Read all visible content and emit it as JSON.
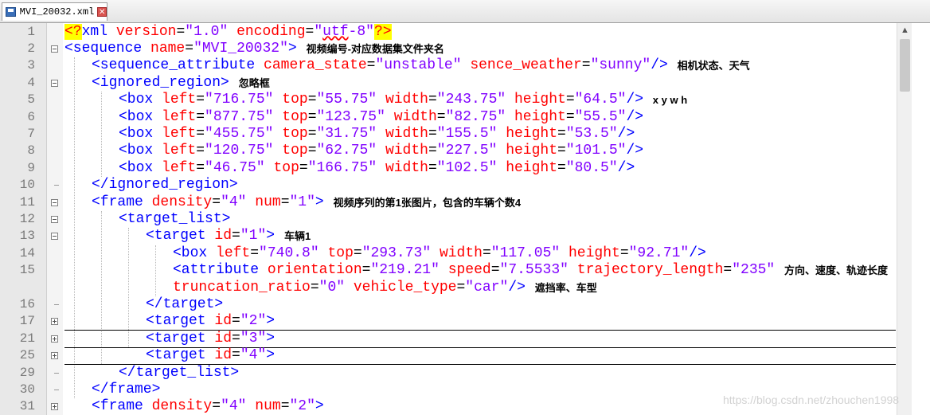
{
  "tab": {
    "label": "MVI_20032.xml",
    "close_glyph": "✕",
    "save_icon": "floppy-disk-icon"
  },
  "scrollbar": {
    "up_glyph": "▲"
  },
  "lines": [
    {
      "num": "1",
      "indent": 0,
      "fold": "none",
      "tokens": [
        {
          "t": "<?",
          "c": "pi"
        },
        {
          "t": "xml ",
          "c": "tag"
        },
        {
          "t": "version",
          "c": "attr"
        },
        {
          "t": "=",
          "c": "plain"
        },
        {
          "t": "\"1.0\"",
          "c": "val"
        },
        {
          "t": " ",
          "c": "plain"
        },
        {
          "t": "encoding",
          "c": "attr"
        },
        {
          "t": "=",
          "c": "plain"
        },
        {
          "t": "\"",
          "c": "val"
        },
        {
          "t": "utf",
          "c": "val-squig"
        },
        {
          "t": "-8\"",
          "c": "val"
        },
        {
          "t": "?>",
          "c": "pi"
        }
      ]
    },
    {
      "num": "2",
      "indent": 0,
      "fold": "minus",
      "tokens": [
        {
          "t": "<sequence ",
          "c": "tag"
        },
        {
          "t": "name",
          "c": "attr"
        },
        {
          "t": "=",
          "c": "plain"
        },
        {
          "t": "\"MVI_20032\"",
          "c": "val"
        },
        {
          "t": ">",
          "c": "tag"
        }
      ]
    },
    {
      "num": "3",
      "indent": 1,
      "fold": "none",
      "tokens": [
        {
          "t": "<sequence_attribute ",
          "c": "tag"
        },
        {
          "t": "camera_state",
          "c": "attr"
        },
        {
          "t": "=",
          "c": "plain"
        },
        {
          "t": "\"unstable\"",
          "c": "val"
        },
        {
          "t": " ",
          "c": "plain"
        },
        {
          "t": "sence_weather",
          "c": "attr"
        },
        {
          "t": "=",
          "c": "plain"
        },
        {
          "t": "\"sunny\"",
          "c": "val"
        },
        {
          "t": "/>",
          "c": "tag"
        }
      ]
    },
    {
      "num": "4",
      "indent": 1,
      "fold": "minus",
      "tokens": [
        {
          "t": "<ignored_region>",
          "c": "tag"
        }
      ]
    },
    {
      "num": "5",
      "indent": 2,
      "fold": "none",
      "tokens": [
        {
          "t": "<box ",
          "c": "tag"
        },
        {
          "t": "left",
          "c": "attr"
        },
        {
          "t": "=",
          "c": "plain"
        },
        {
          "t": "\"716.75\"",
          "c": "val"
        },
        {
          "t": " ",
          "c": "plain"
        },
        {
          "t": "top",
          "c": "attr"
        },
        {
          "t": "=",
          "c": "plain"
        },
        {
          "t": "\"55.75\"",
          "c": "val"
        },
        {
          "t": " ",
          "c": "plain"
        },
        {
          "t": "width",
          "c": "attr"
        },
        {
          "t": "=",
          "c": "plain"
        },
        {
          "t": "\"243.75\"",
          "c": "val"
        },
        {
          "t": " ",
          "c": "plain"
        },
        {
          "t": "height",
          "c": "attr"
        },
        {
          "t": "=",
          "c": "plain"
        },
        {
          "t": "\"64.5\"",
          "c": "val"
        },
        {
          "t": "/>",
          "c": "tag"
        }
      ]
    },
    {
      "num": "6",
      "indent": 2,
      "fold": "none",
      "tokens": [
        {
          "t": "<box ",
          "c": "tag"
        },
        {
          "t": "left",
          "c": "attr"
        },
        {
          "t": "=",
          "c": "plain"
        },
        {
          "t": "\"877.75\"",
          "c": "val"
        },
        {
          "t": " ",
          "c": "plain"
        },
        {
          "t": "top",
          "c": "attr"
        },
        {
          "t": "=",
          "c": "plain"
        },
        {
          "t": "\"123.75\"",
          "c": "val"
        },
        {
          "t": " ",
          "c": "plain"
        },
        {
          "t": "width",
          "c": "attr"
        },
        {
          "t": "=",
          "c": "plain"
        },
        {
          "t": "\"82.75\"",
          "c": "val"
        },
        {
          "t": " ",
          "c": "plain"
        },
        {
          "t": "height",
          "c": "attr"
        },
        {
          "t": "=",
          "c": "plain"
        },
        {
          "t": "\"55.5\"",
          "c": "val"
        },
        {
          "t": "/>",
          "c": "tag"
        }
      ]
    },
    {
      "num": "7",
      "indent": 2,
      "fold": "none",
      "tokens": [
        {
          "t": "<box ",
          "c": "tag"
        },
        {
          "t": "left",
          "c": "attr"
        },
        {
          "t": "=",
          "c": "plain"
        },
        {
          "t": "\"455.75\"",
          "c": "val"
        },
        {
          "t": " ",
          "c": "plain"
        },
        {
          "t": "top",
          "c": "attr"
        },
        {
          "t": "=",
          "c": "plain"
        },
        {
          "t": "\"31.75\"",
          "c": "val"
        },
        {
          "t": " ",
          "c": "plain"
        },
        {
          "t": "width",
          "c": "attr"
        },
        {
          "t": "=",
          "c": "plain"
        },
        {
          "t": "\"155.5\"",
          "c": "val"
        },
        {
          "t": " ",
          "c": "plain"
        },
        {
          "t": "height",
          "c": "attr"
        },
        {
          "t": "=",
          "c": "plain"
        },
        {
          "t": "\"53.5\"",
          "c": "val"
        },
        {
          "t": "/>",
          "c": "tag"
        }
      ]
    },
    {
      "num": "8",
      "indent": 2,
      "fold": "none",
      "tokens": [
        {
          "t": "<box ",
          "c": "tag"
        },
        {
          "t": "left",
          "c": "attr"
        },
        {
          "t": "=",
          "c": "plain"
        },
        {
          "t": "\"120.75\"",
          "c": "val"
        },
        {
          "t": " ",
          "c": "plain"
        },
        {
          "t": "top",
          "c": "attr"
        },
        {
          "t": "=",
          "c": "plain"
        },
        {
          "t": "\"62.75\"",
          "c": "val"
        },
        {
          "t": " ",
          "c": "plain"
        },
        {
          "t": "width",
          "c": "attr"
        },
        {
          "t": "=",
          "c": "plain"
        },
        {
          "t": "\"227.5\"",
          "c": "val"
        },
        {
          "t": " ",
          "c": "plain"
        },
        {
          "t": "height",
          "c": "attr"
        },
        {
          "t": "=",
          "c": "plain"
        },
        {
          "t": "\"101.5\"",
          "c": "val"
        },
        {
          "t": "/>",
          "c": "tag"
        }
      ]
    },
    {
      "num": "9",
      "indent": 2,
      "fold": "none",
      "tokens": [
        {
          "t": "<box ",
          "c": "tag"
        },
        {
          "t": "left",
          "c": "attr"
        },
        {
          "t": "=",
          "c": "plain"
        },
        {
          "t": "\"46.75\"",
          "c": "val"
        },
        {
          "t": " ",
          "c": "plain"
        },
        {
          "t": "top",
          "c": "attr"
        },
        {
          "t": "=",
          "c": "plain"
        },
        {
          "t": "\"166.75\"",
          "c": "val"
        },
        {
          "t": " ",
          "c": "plain"
        },
        {
          "t": "width",
          "c": "attr"
        },
        {
          "t": "=",
          "c": "plain"
        },
        {
          "t": "\"102.5\"",
          "c": "val"
        },
        {
          "t": " ",
          "c": "plain"
        },
        {
          "t": "height",
          "c": "attr"
        },
        {
          "t": "=",
          "c": "plain"
        },
        {
          "t": "\"80.5\"",
          "c": "val"
        },
        {
          "t": "/>",
          "c": "tag"
        }
      ]
    },
    {
      "num": "10",
      "indent": 1,
      "fold": "end",
      "tokens": [
        {
          "t": "</ignored_region>",
          "c": "tag"
        }
      ]
    },
    {
      "num": "11",
      "indent": 1,
      "fold": "minus",
      "tokens": [
        {
          "t": "<frame ",
          "c": "tag"
        },
        {
          "t": "density",
          "c": "attr"
        },
        {
          "t": "=",
          "c": "plain"
        },
        {
          "t": "\"4\"",
          "c": "val"
        },
        {
          "t": " ",
          "c": "plain"
        },
        {
          "t": "num",
          "c": "attr"
        },
        {
          "t": "=",
          "c": "plain"
        },
        {
          "t": "\"1\"",
          "c": "val"
        },
        {
          "t": ">",
          "c": "tag"
        }
      ]
    },
    {
      "num": "12",
      "indent": 2,
      "fold": "minus",
      "tokens": [
        {
          "t": "<target_list>",
          "c": "tag"
        }
      ]
    },
    {
      "num": "13",
      "indent": 3,
      "fold": "minus",
      "tokens": [
        {
          "t": "<target ",
          "c": "tag"
        },
        {
          "t": "id",
          "c": "attr"
        },
        {
          "t": "=",
          "c": "plain"
        },
        {
          "t": "\"1\"",
          "c": "val"
        },
        {
          "t": ">",
          "c": "tag"
        }
      ]
    },
    {
      "num": "14",
      "indent": 4,
      "fold": "none",
      "tokens": [
        {
          "t": "<box ",
          "c": "tag"
        },
        {
          "t": "left",
          "c": "attr"
        },
        {
          "t": "=",
          "c": "plain"
        },
        {
          "t": "\"740.8\"",
          "c": "val"
        },
        {
          "t": " ",
          "c": "plain"
        },
        {
          "t": "top",
          "c": "attr"
        },
        {
          "t": "=",
          "c": "plain"
        },
        {
          "t": "\"293.73\"",
          "c": "val"
        },
        {
          "t": " ",
          "c": "plain"
        },
        {
          "t": "width",
          "c": "attr"
        },
        {
          "t": "=",
          "c": "plain"
        },
        {
          "t": "\"117.05\"",
          "c": "val"
        },
        {
          "t": " ",
          "c": "plain"
        },
        {
          "t": "height",
          "c": "attr"
        },
        {
          "t": "=",
          "c": "plain"
        },
        {
          "t": "\"92.71\"",
          "c": "val"
        },
        {
          "t": "/>",
          "c": "tag"
        }
      ]
    },
    {
      "num": "15",
      "indent": 4,
      "fold": "none",
      "tokens": [
        {
          "t": "<attribute ",
          "c": "tag"
        },
        {
          "t": "orientation",
          "c": "attr"
        },
        {
          "t": "=",
          "c": "plain"
        },
        {
          "t": "\"219.21\"",
          "c": "val"
        },
        {
          "t": " ",
          "c": "plain"
        },
        {
          "t": "speed",
          "c": "attr"
        },
        {
          "t": "=",
          "c": "plain"
        },
        {
          "t": "\"7.5533\"",
          "c": "val"
        },
        {
          "t": " ",
          "c": "plain"
        },
        {
          "t": "trajectory_length",
          "c": "attr"
        },
        {
          "t": "=",
          "c": "plain"
        },
        {
          "t": "\"235\"",
          "c": "val"
        }
      ]
    },
    {
      "num": "",
      "indent": 4,
      "fold": "none",
      "tokens": [
        {
          "t": "truncation_ratio",
          "c": "attr"
        },
        {
          "t": "=",
          "c": "plain"
        },
        {
          "t": "\"0\"",
          "c": "val"
        },
        {
          "t": " ",
          "c": "plain"
        },
        {
          "t": "vehicle_type",
          "c": "attr"
        },
        {
          "t": "=",
          "c": "plain"
        },
        {
          "t": "\"car\"",
          "c": "val"
        },
        {
          "t": "/>",
          "c": "tag"
        }
      ]
    },
    {
      "num": "16",
      "indent": 3,
      "fold": "end",
      "tokens": [
        {
          "t": "</target>",
          "c": "tag"
        }
      ]
    },
    {
      "num": "17",
      "indent": 3,
      "fold": "plus",
      "sep": true,
      "tokens": [
        {
          "t": "<target ",
          "c": "tag"
        },
        {
          "t": "id",
          "c": "attr"
        },
        {
          "t": "=",
          "c": "plain"
        },
        {
          "t": "\"2\"",
          "c": "val"
        },
        {
          "t": ">",
          "c": "tag"
        }
      ]
    },
    {
      "num": "21",
      "indent": 3,
      "fold": "plus",
      "sep": true,
      "tokens": [
        {
          "t": "<target ",
          "c": "tag"
        },
        {
          "t": "id",
          "c": "attr"
        },
        {
          "t": "=",
          "c": "plain"
        },
        {
          "t": "\"3\"",
          "c": "val"
        },
        {
          "t": ">",
          "c": "tag"
        }
      ]
    },
    {
      "num": "25",
      "indent": 3,
      "fold": "plus",
      "sep": true,
      "tokens": [
        {
          "t": "<target ",
          "c": "tag"
        },
        {
          "t": "id",
          "c": "attr"
        },
        {
          "t": "=",
          "c": "plain"
        },
        {
          "t": "\"4\"",
          "c": "val"
        },
        {
          "t": ">",
          "c": "tag"
        }
      ]
    },
    {
      "num": "29",
      "indent": 2,
      "fold": "end",
      "tokens": [
        {
          "t": "</target_list>",
          "c": "tag"
        }
      ]
    },
    {
      "num": "30",
      "indent": 1,
      "fold": "end",
      "tokens": [
        {
          "t": "</frame>",
          "c": "tag"
        }
      ]
    },
    {
      "num": "31",
      "indent": 1,
      "fold": "plus",
      "sep": true,
      "tokens": [
        {
          "t": "<frame ",
          "c": "tag"
        },
        {
          "t": "density",
          "c": "attr"
        },
        {
          "t": "=",
          "c": "plain"
        },
        {
          "t": "\"4\"",
          "c": "val"
        },
        {
          "t": " ",
          "c": "plain"
        },
        {
          "t": "num",
          "c": "attr"
        },
        {
          "t": "=",
          "c": "plain"
        },
        {
          "t": "\"2\"",
          "c": "val"
        },
        {
          "t": ">",
          "c": "tag"
        }
      ]
    }
  ],
  "annotations": [
    {
      "line": 1,
      "text": "视频编号-对应数据集文件夹名"
    },
    {
      "line": 2,
      "text": "相机状态、天气"
    },
    {
      "line": 3,
      "text": "忽略框"
    },
    {
      "line": 4,
      "text": "x y w h"
    },
    {
      "line": 10,
      "text": "视频序列的第1张图片，包含的车辆个数4"
    },
    {
      "line": 12,
      "text": "车辆1"
    },
    {
      "line": 14,
      "text": "方向、速度、轨迹长度"
    },
    {
      "line": 15,
      "text": "遮挡率、车型"
    }
  ],
  "watermark": "https://blog.csdn.net/zhouchen1998"
}
